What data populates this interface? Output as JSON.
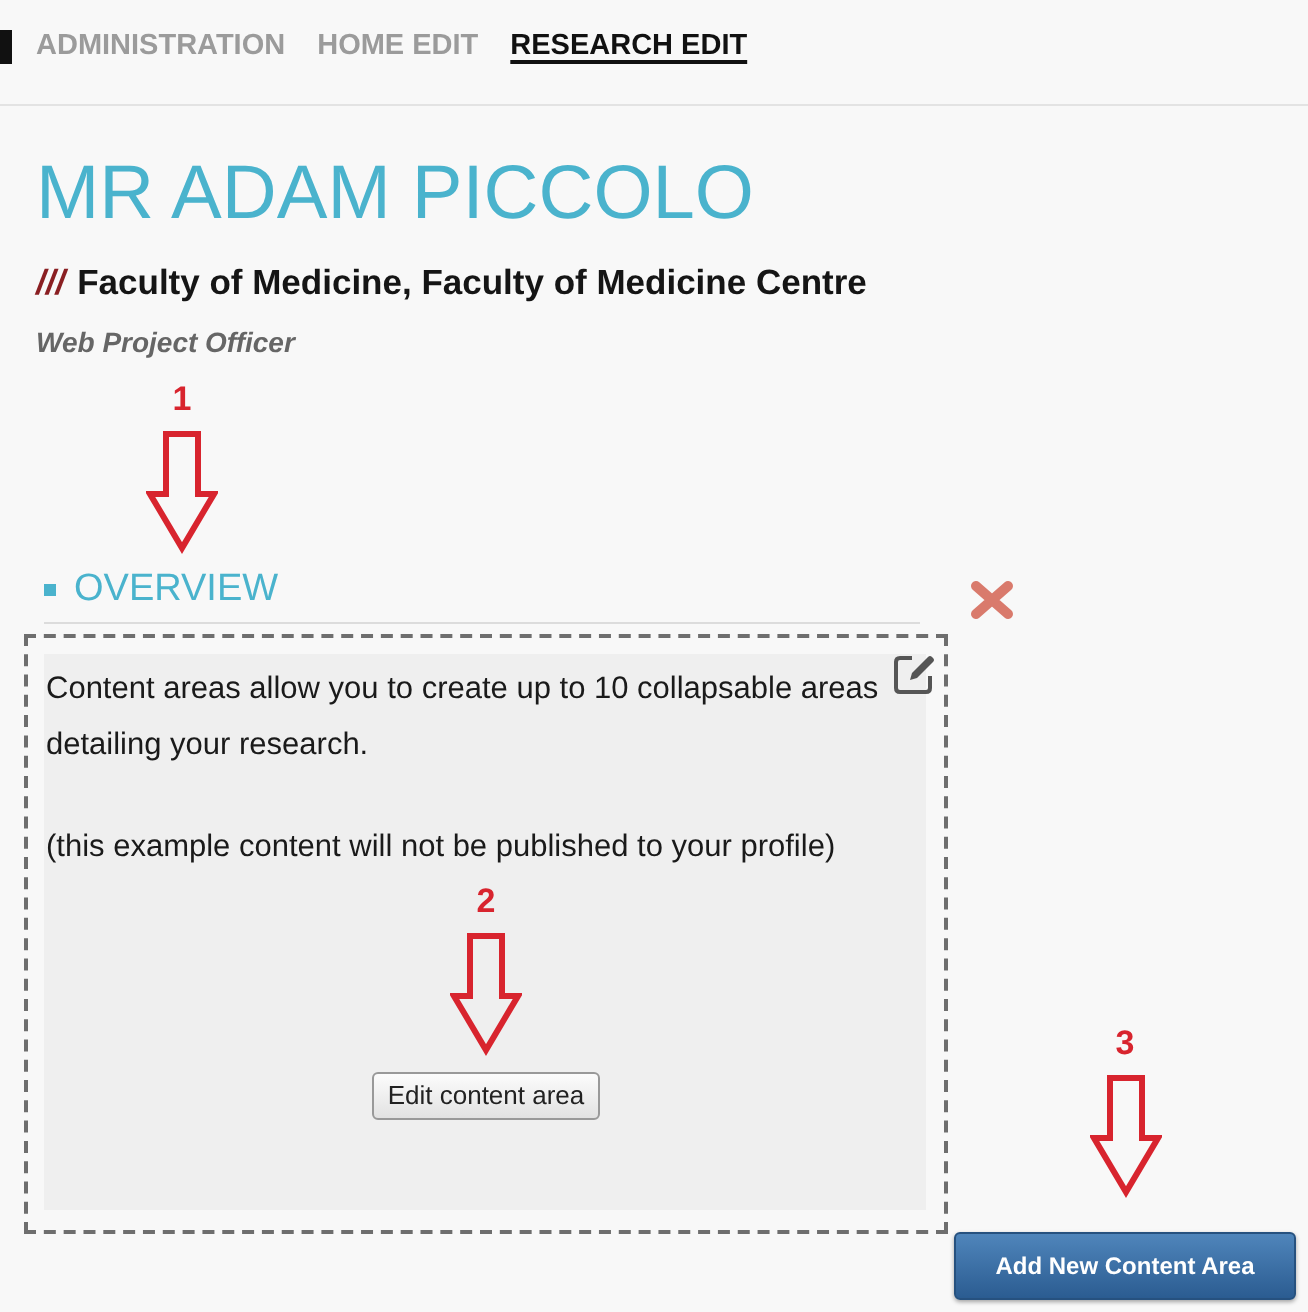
{
  "nav": {
    "items": [
      {
        "label": "ADMINISTRATION",
        "selected": false
      },
      {
        "label": "HOME EDIT",
        "selected": false
      },
      {
        "label": "RESEARCH EDIT",
        "selected": true
      }
    ]
  },
  "profile": {
    "name": "MR ADAM PICCOLO",
    "department_mark": "///",
    "department": "Faculty of Medicine, Faculty of Medicine Centre",
    "position": "Web Project Officer"
  },
  "section": {
    "title": "OVERVIEW",
    "content_area": {
      "paragraphs": [
        "Content areas allow you to create up to 10 collapsable areas detailing your research.",
        "(this example content will not be published to your profile)"
      ],
      "edit_button": "Edit content area"
    }
  },
  "add_button": "Add New Content Area",
  "annotations": [
    {
      "label": "1"
    },
    {
      "label": "2"
    },
    {
      "label": "3"
    }
  ]
}
